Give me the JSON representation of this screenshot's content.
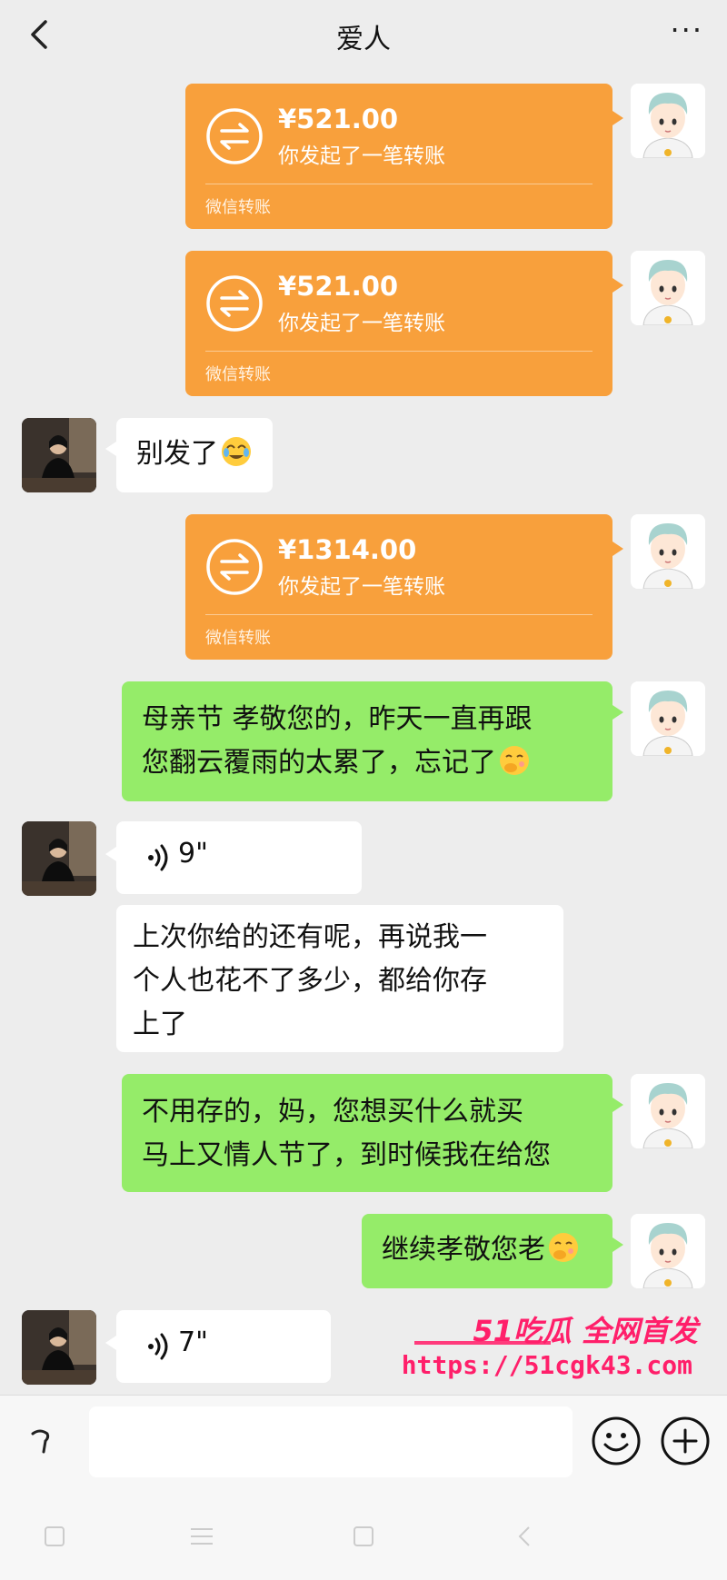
{
  "header": {
    "title": "爱人",
    "more_label": "···"
  },
  "transfer_1": {
    "amount": "¥521.00",
    "desc": "你发起了一笔转账",
    "footer": "微信转账"
  },
  "transfer_2": {
    "amount": "¥521.00",
    "desc": "你发起了一笔转账",
    "footer": "微信转账"
  },
  "msg_mom_1": {
    "text": "别发了",
    "emoji": "smiling-tears-emoji"
  },
  "transfer_3": {
    "amount": "¥1314.00",
    "desc": "你发起了一笔转账",
    "footer": "微信转账"
  },
  "msg_me_1": {
    "line1": "母亲节 孝敬您的，昨天一直再跟",
    "line2": "您翻云覆雨的太累了，忘记了",
    "emoji": "shy-face-emoji"
  },
  "voice_1": {
    "duration": "9\""
  },
  "msg_mom_2": {
    "line1": "上次你给的还有呢，再说我一",
    "line2": "个人也花不了多少，都给你存",
    "line3": "上了"
  },
  "msg_me_2": {
    "line1": "不用存的，妈，您想买什么就买",
    "line2": "马上又情人节了，到时候我在给您"
  },
  "msg_me_3": {
    "text": "继续孝敬您老",
    "emoji": "shy-face-emoji"
  },
  "voice_2": {
    "duration": "7\""
  },
  "watermark": {
    "brand": "51吃瓜 全网首发",
    "url": "https://51cgk43.com"
  },
  "input": {
    "placeholder": ""
  },
  "colors": {
    "transfer_orange": "#f8a03c",
    "sent_green": "#95ec69",
    "background": "#ededed",
    "watermark_pink": "#ff1f6a"
  }
}
